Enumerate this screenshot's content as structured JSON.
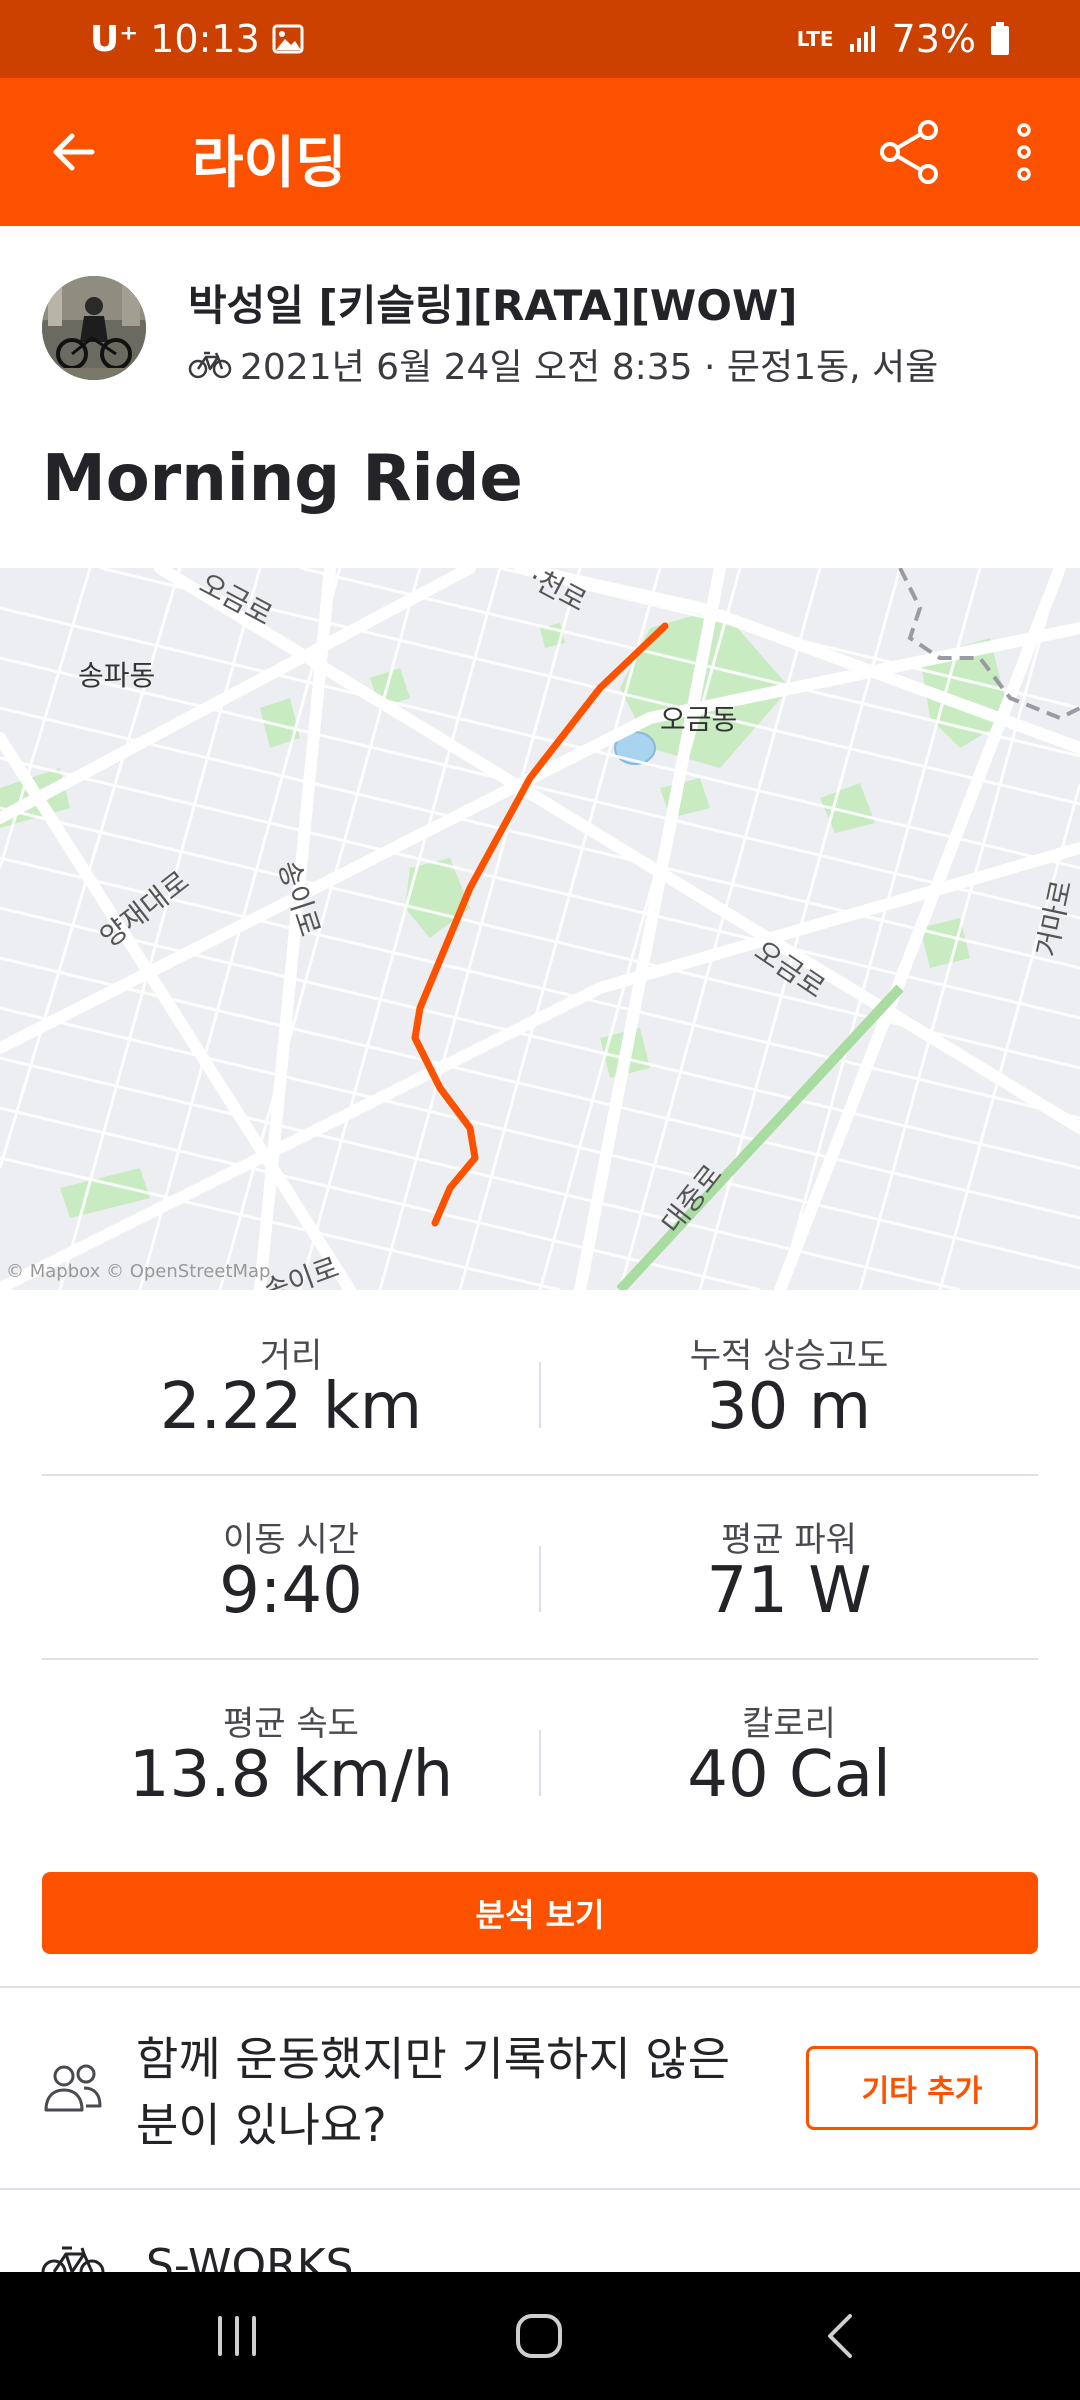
{
  "status_bar": {
    "carrier": "U⁺",
    "time": "10:13",
    "network": "LTE",
    "battery": "73%"
  },
  "app_bar": {
    "title": "라이딩"
  },
  "activity": {
    "athlete_name": "박성일 [키슬링][RATA][WOW]",
    "date_location": "2021년 6월 24일 오전 8:35 · 문정1동, 서울",
    "title": "Morning Ride"
  },
  "map": {
    "labels": {
      "ogeum_ro_top": "오금로",
      "songpa_dong": "송파동",
      "cheon_ro_top": "·천로",
      "ogeum_dong": "오금동",
      "yangjae_daero": "양재대로",
      "songi_ro": "송이로",
      "ogeum_ro_right": "오금로",
      "right_edge_road": "거마로",
      "bottom_road": "대중로",
      "bottom_left_road": "송이로"
    },
    "attribution": "© Mapbox © OpenStreetMap"
  },
  "stats": [
    {
      "label": "거리",
      "value": "2.22 km"
    },
    {
      "label": "누적 상승고도",
      "value": "30 m"
    },
    {
      "label": "이동 시간",
      "value": "9:40"
    },
    {
      "label": "평균 파워",
      "value": "71 W"
    },
    {
      "label": "평균 속도",
      "value": "13.8 km/h"
    },
    {
      "label": "칼로리",
      "value": "40 Cal"
    }
  ],
  "buttons": {
    "analysis": "분석 보기",
    "add_other": "기타 추가"
  },
  "together": {
    "question": "함께 운동했지만 기록하지 않은 분이 있나요?"
  },
  "gear": {
    "name": "S-WORKS"
  },
  "colors": {
    "accent": "#fc5200",
    "status_bar": "#cc4100",
    "route": "#fc5200"
  },
  "icons": {
    "back": "arrow-left-icon",
    "share": "share-icon",
    "more": "more-vertical-icon",
    "bike": "bike-icon",
    "people": "people-icon"
  }
}
